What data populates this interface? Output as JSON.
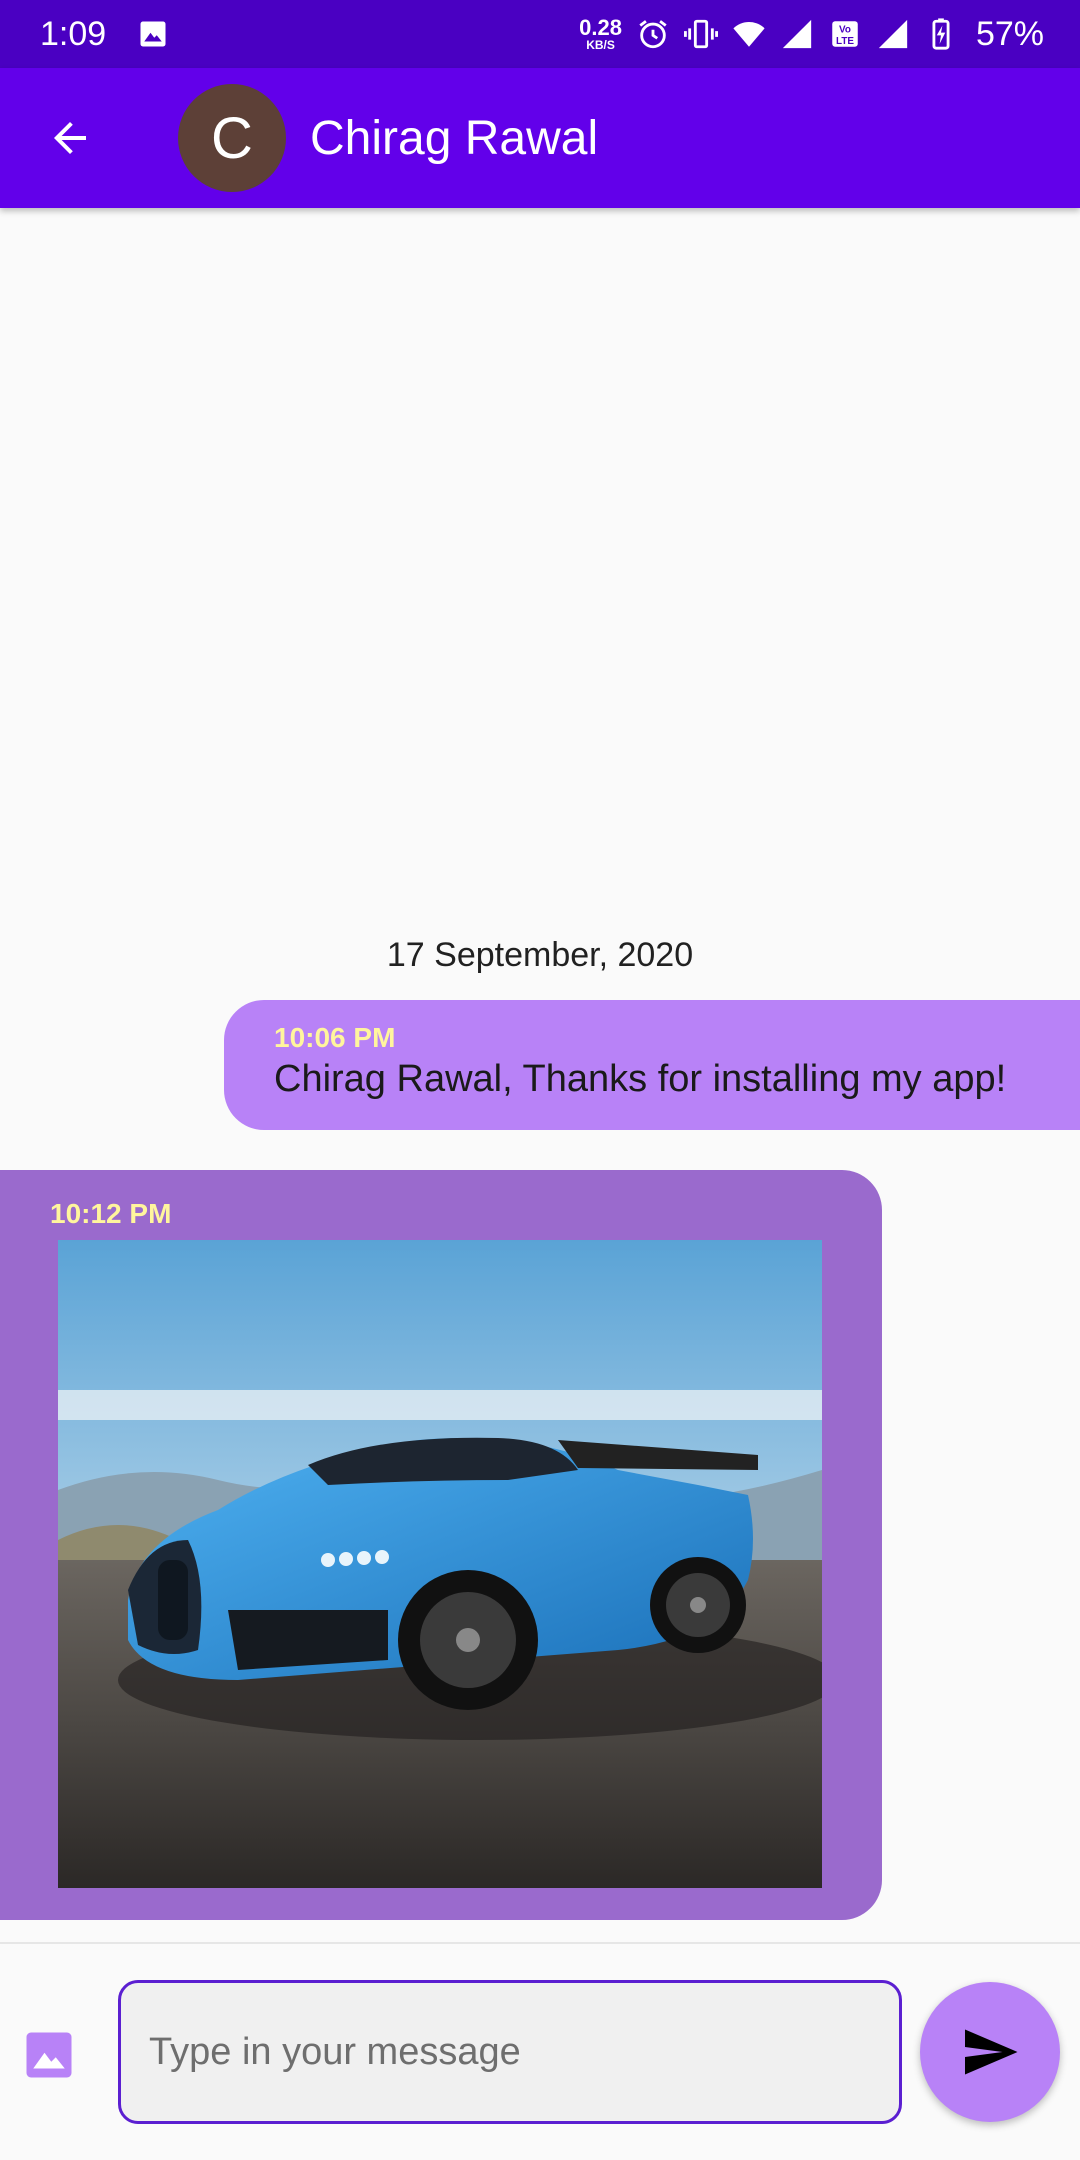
{
  "status_bar": {
    "time": "1:09",
    "net_speed_value": "0.28",
    "net_speed_unit": "KB/S",
    "battery_percent": "57%",
    "icons": [
      "gallery-icon",
      "alarm-icon",
      "vibrate-icon",
      "wifi-icon",
      "signal-icon",
      "volte-icon",
      "signal-icon",
      "battery-charging-icon"
    ]
  },
  "header": {
    "back_icon": "back-arrow-icon",
    "avatar_initial": "C",
    "contact_name": "Chirag Rawal",
    "colors": {
      "app_bar": "#6200ea",
      "status_bar": "#4a00c2",
      "avatar": "#5d4037"
    }
  },
  "chat": {
    "date_separator": "17 September, 2020",
    "messages": [
      {
        "direction": "outgoing",
        "time": "10:06 PM",
        "text": "Chirag Rawal, Thanks for installing my app!",
        "bubble_color": "#b882f7"
      },
      {
        "direction": "incoming",
        "time": "10:12 PM",
        "type": "image",
        "bubble_color": "#9a6acd"
      }
    ],
    "time_color": "#fff59d"
  },
  "composer": {
    "attach_icon": "image-attach-icon",
    "placeholder": "Type in your message",
    "value": "",
    "send_icon": "send-icon",
    "send_color": "#b882f7"
  }
}
